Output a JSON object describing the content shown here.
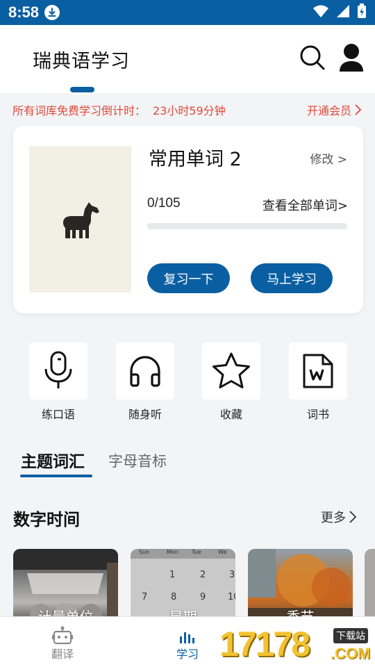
{
  "status_bar": {
    "time": "8:58"
  },
  "header": {
    "title": "瑞典语学习"
  },
  "promo": {
    "text": "所有词库免费学习倒计时：",
    "countdown": "23小时59分钟",
    "vip_link": "开通会员"
  },
  "book": {
    "title": "常用单词 2",
    "edit_label": "修改 >",
    "progress_label": "0/105",
    "progress_fraction": 0,
    "view_all_label": "查看全部单词>",
    "review_label": "复习一下",
    "learn_label": "马上学习"
  },
  "tools": [
    {
      "label": "练口语",
      "icon": "microphone-icon"
    },
    {
      "label": "随身听",
      "icon": "headphones-icon"
    },
    {
      "label": "收藏",
      "icon": "star-icon"
    },
    {
      "label": "词书",
      "icon": "word-file-icon"
    }
  ],
  "tabs": {
    "active": "主题词汇",
    "inactive": "字母音标"
  },
  "section": {
    "title": "数字时间",
    "more_label": "更多"
  },
  "topics": [
    {
      "label": "计量单位"
    },
    {
      "label": "星期"
    },
    {
      "label": "季节"
    }
  ],
  "calendar": {
    "days": [
      "Sun",
      "Mon",
      "Tue",
      "We"
    ],
    "row1": [
      "1",
      "2",
      "3"
    ],
    "row2": [
      "7",
      "8",
      "9",
      "10"
    ]
  },
  "bottom_nav": {
    "items": [
      {
        "label": "翻译",
        "icon": "robot-icon"
      },
      {
        "label": "学习",
        "icon": "bars-icon"
      }
    ]
  },
  "watermark": {
    "number": "17178",
    "tag": "下载站",
    "domain": ".COM"
  },
  "colors": {
    "primary": "#0a5fa3",
    "promo": "#e0483a"
  }
}
